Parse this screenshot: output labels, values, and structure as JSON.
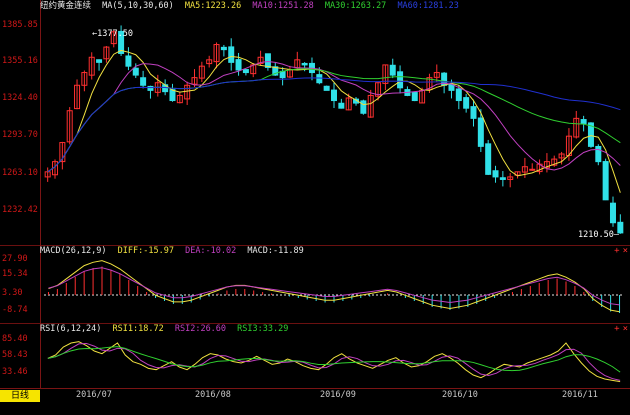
{
  "main_panel": {
    "title": "纽约黄金连续",
    "ma_label": "MA(5,10,30,60)",
    "ma5": "MA5:1223.26",
    "ma10": "MA10:1251.28",
    "ma30": "MA30:1263.27",
    "ma60": "MA60:1281.23",
    "high_label": "1377.50",
    "low_label": "1210.50",
    "y_ticks": [
      "1385.85",
      "1355.16",
      "1324.40",
      "1293.70",
      "1263.10",
      "1232.42"
    ]
  },
  "macd_panel": {
    "label": "MACD(26,12,9)",
    "diff": "DIFF:-15.97",
    "dea": "DEA:-10.02",
    "macd": "MACD:-11.89",
    "y_ticks": [
      "27.90",
      "15.34",
      "3.30",
      "-8.74"
    ]
  },
  "rsi_panel": {
    "label": "RSI(6,12,24)",
    "rsi1": "RSI1:18.72",
    "rsi2": "RSI2:26.60",
    "rsi3": "RSI3:33.29",
    "y_ticks": [
      "85.40",
      "58.43",
      "33.46"
    ]
  },
  "x_axis": {
    "months": [
      "2016/07",
      "2016/08",
      "2016/09",
      "2016/10",
      "2016/11"
    ]
  },
  "bottom_tab": "日线",
  "panel_buttons": [
    "+",
    "×"
  ],
  "colors": {
    "up": "#ff3030",
    "down": "#30e0e8",
    "ma5": "#e8e8e8",
    "ma10": "#f0e040",
    "ma30": "#c040c0",
    "ma60": "#30d030",
    "ma_blue": "#2030d0",
    "axis": "#d01818"
  },
  "chart_data": {
    "type": "candlestick",
    "title": "纽约黄金连续",
    "y_range": [
      1210,
      1386
    ],
    "x_months": [
      "2016/07",
      "2016/08",
      "2016/09",
      "2016/10",
      "2016/11"
    ],
    "annotations": [
      {
        "text": "1377.50",
        "kind": "high"
      },
      {
        "text": "1210.50",
        "kind": "low"
      }
    ],
    "indicators": {
      "MA5": 1223.26,
      "MA10": 1251.28,
      "MA30": 1263.27,
      "MA60": 1281.23,
      "DIFF": -15.97,
      "DEA": -10.02,
      "MACD": -11.89,
      "RSI1": 18.72,
      "RSI2": 26.6,
      "RSI3": 33.29
    },
    "close_series": [
      1262,
      1270,
      1285,
      1310,
      1330,
      1340,
      1352,
      1348,
      1360,
      1372,
      1355,
      1345,
      1338,
      1330,
      1326,
      1332,
      1325,
      1318,
      1322,
      1330,
      1336,
      1345,
      1350,
      1362,
      1358,
      1348,
      1342,
      1340,
      1346,
      1352,
      1344,
      1338,
      1336,
      1342,
      1350,
      1346,
      1340,
      1332,
      1326,
      1318,
      1312,
      1320,
      1316,
      1308,
      1322,
      1332,
      1346,
      1338,
      1328,
      1322,
      1318,
      1326,
      1336,
      1340,
      1330,
      1326,
      1318,
      1312,
      1304,
      1282,
      1260,
      1258,
      1256,
      1258,
      1262,
      1266,
      1264,
      1268,
      1270,
      1272,
      1276,
      1290,
      1304,
      1300,
      1282,
      1270,
      1240,
      1222,
      1214
    ],
    "macd_hist": [
      2,
      4,
      8,
      12,
      16,
      18,
      19,
      17,
      14,
      10,
      6,
      2,
      -2,
      -4,
      -6,
      -6,
      -5,
      -3,
      -1,
      1,
      3,
      4,
      4,
      3,
      2,
      1,
      0,
      -1,
      -2,
      -3,
      -4,
      -5,
      -5,
      -4,
      -3,
      -2,
      -1,
      0,
      1,
      0,
      -2,
      -4,
      -6,
      -8,
      -9,
      -10,
      -9,
      -8,
      -6,
      -4,
      -2,
      0,
      2,
      4,
      6,
      8,
      10,
      11,
      9,
      6,
      2,
      -4,
      -8,
      -11,
      -12
    ],
    "rsi_series": [
      55,
      60,
      72,
      78,
      80,
      74,
      66,
      62,
      70,
      78,
      60,
      50,
      46,
      40,
      38,
      44,
      50,
      42,
      38,
      46,
      56,
      62,
      60,
      54,
      50,
      48,
      52,
      58,
      52,
      46,
      48,
      54,
      50,
      44,
      40,
      38,
      46,
      56,
      62,
      54,
      48,
      44,
      40,
      46,
      52,
      56,
      48,
      42,
      44,
      50,
      58,
      62,
      56,
      48,
      38,
      30,
      26,
      32,
      40,
      46,
      44,
      42,
      48,
      52,
      56,
      60,
      66,
      78,
      62,
      48,
      36,
      28,
      24,
      22,
      20
    ]
  }
}
